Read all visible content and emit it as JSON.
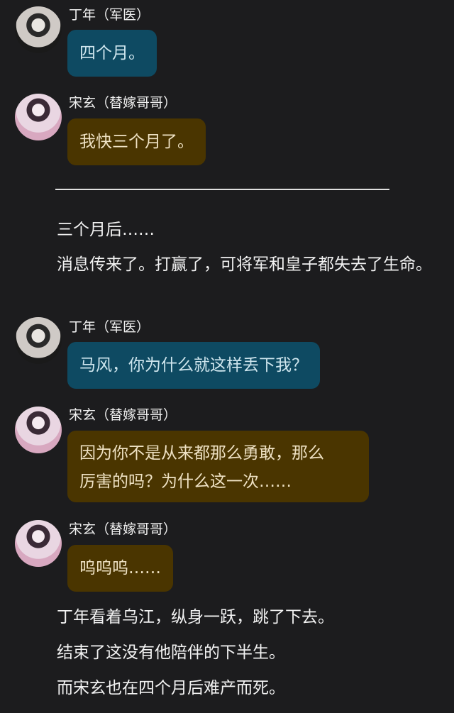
{
  "characters": {
    "dingnian": "丁年（军医）",
    "songxuan": "宋玄（替嫁哥哥）"
  },
  "messages": [
    {
      "speaker": "丁年（军医）",
      "text": "四个月。",
      "style": "blue"
    },
    {
      "speaker": "宋玄（替嫁哥哥）",
      "text": "我快三个月了。",
      "style": "brown"
    }
  ],
  "narration1": [
    "三个月后……",
    "消息传来了。打赢了，可将军和皇子都失去了生命。"
  ],
  "messages2": [
    {
      "speaker": "丁年（军医）",
      "text": "马风，你为什么就这样丢下我？",
      "style": "blue"
    },
    {
      "speaker": "宋玄（替嫁哥哥）",
      "line1": "因为你不是从来都那么勇敢，那么",
      "line2": "厉害的吗？为什么这一次……",
      "style": "brown"
    },
    {
      "speaker": "宋玄（替嫁哥哥）",
      "text": "呜呜呜……",
      "style": "brown"
    }
  ],
  "narration2": [
    "丁年看着乌江，纵身一跃，跳了下去。",
    "结束了这没有他陪伴的下半生。",
    "而宋玄也在四个月后难产而死。"
  ],
  "colors": {
    "background": "#1c1c1e",
    "blue_bubble": "#0e4a62",
    "brown_bubble": "#4a3500"
  }
}
